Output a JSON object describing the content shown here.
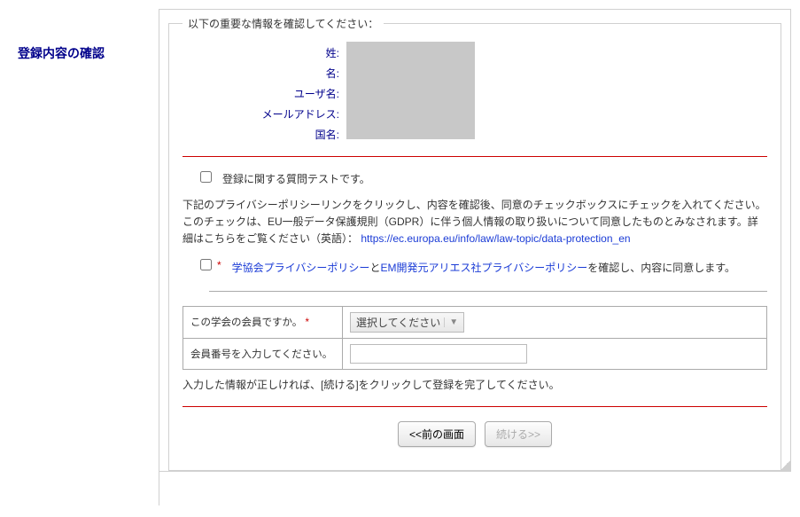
{
  "sidebar": {
    "title": "登録内容の確認"
  },
  "fieldset": {
    "legend": "以下の重要な情報を確認してください："
  },
  "labels": {
    "surname": "姓:",
    "given": "名:",
    "username": "ユーザ名:",
    "email": "メールアドレス:",
    "country": "国名:"
  },
  "question": {
    "label": "登録に関する質問テストです。"
  },
  "privacy": {
    "text": "下記のプライバシーポリシーリンクをクリックし、内容を確認後、同意のチェックボックスにチェックを入れてください。このチェックは、EU一般データ保護規則（GDPR）に伴う個人情報の取り扱いについて同意したものとみなされます。詳細はこちらをご覧ください（英語）：",
    "link": "https://ec.europa.eu/info/law/law-topic/data-protection_en",
    "consent_link1": "学協会プライバシーポリシー",
    "consent_mid": "と",
    "consent_link2": "EM開発元アリエス社プライバシーポリシー",
    "consent_tail": "を確認し、内容に同意します。",
    "req": "*"
  },
  "membership": {
    "q_label": "この学会の会員ですか。",
    "q_req": "*",
    "select_placeholder": "選択してください",
    "number_label": "会員番号を入力してください。"
  },
  "instruction": "入力した情報が正しければ、[続ける]をクリックして登録を完了してください。",
  "buttons": {
    "back": "<<前の画面",
    "continue": "続ける>>"
  }
}
